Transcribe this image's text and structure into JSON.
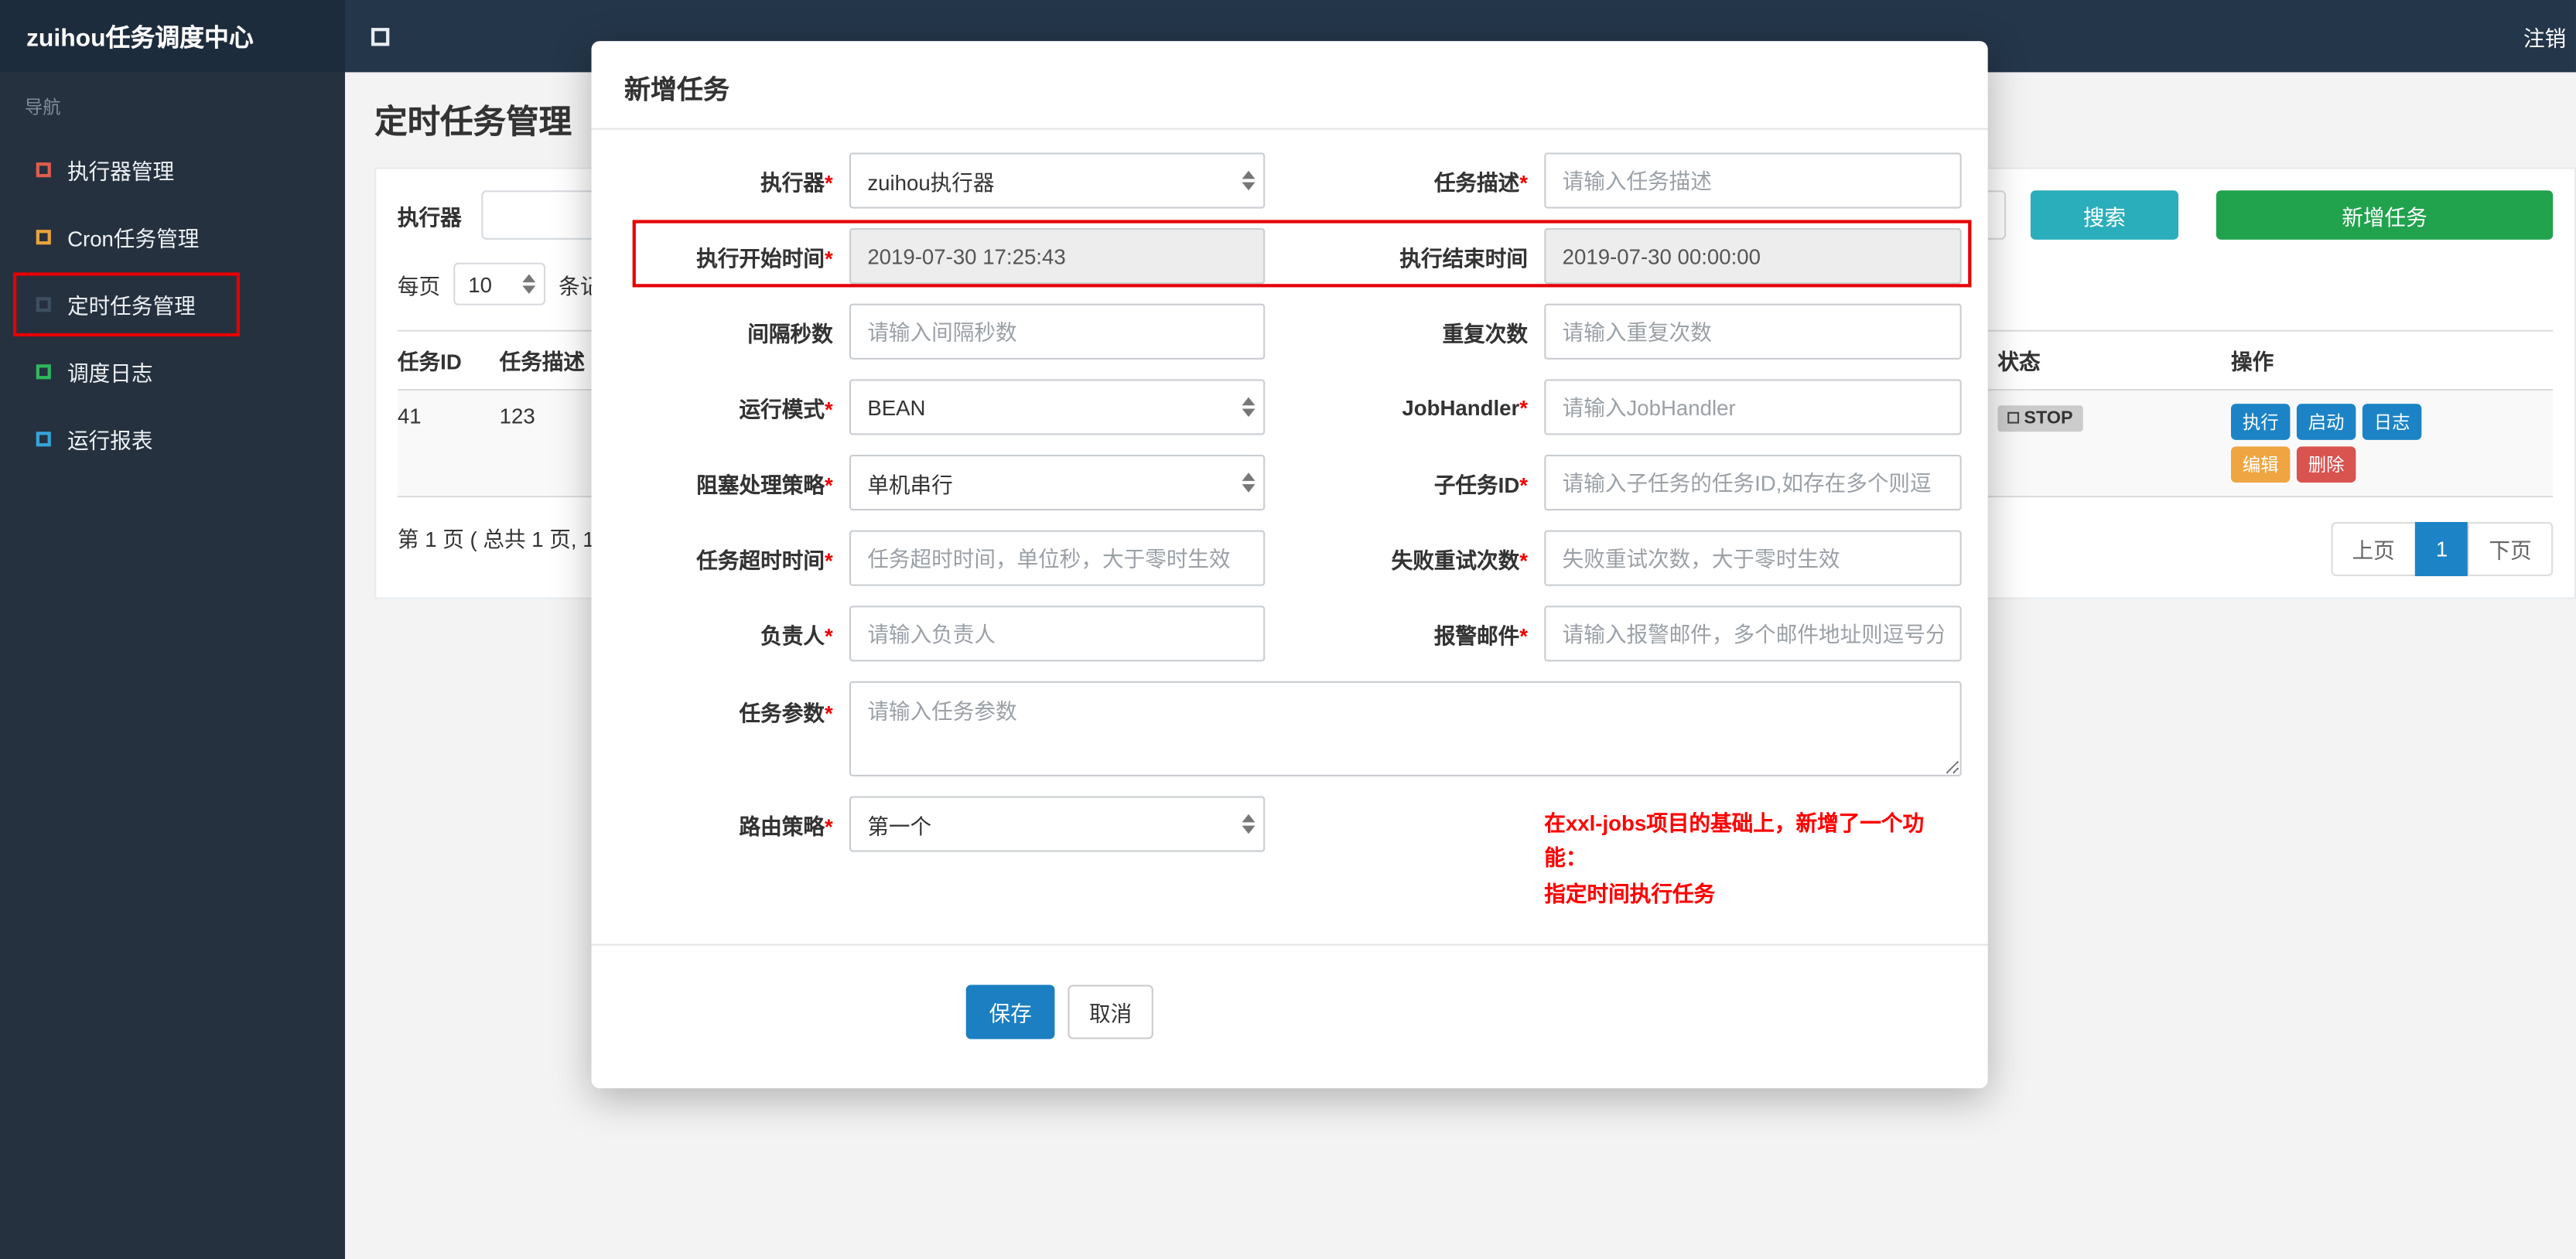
{
  "navbar": {
    "brand": "zuihou任务调度中心",
    "logout": "注销"
  },
  "sidebar": {
    "nav_label": "导航",
    "items": [
      {
        "label": "执行器管理",
        "icon_color": "#e05c4c"
      },
      {
        "label": "Cron任务管理",
        "icon_color": "#e9a33b"
      },
      {
        "label": "定时任务管理",
        "icon_color": "#3d4f61"
      },
      {
        "label": "调度日志",
        "icon_color": "#2eb85c"
      },
      {
        "label": "运行报表",
        "icon_color": "#36a3d9"
      }
    ]
  },
  "page": {
    "title": "定时任务管理",
    "filter": {
      "executor_label": "执行器",
      "search_button": "搜索",
      "add_button": "新增任务"
    },
    "page_size": {
      "prefix": "每页",
      "value": "10",
      "suffix": "条记录"
    },
    "table": {
      "columns": {
        "id": "任务ID",
        "desc": "任务描述",
        "status": "状态",
        "ops": "操作"
      },
      "row": {
        "id": "41",
        "desc": "123",
        "status": "STOP",
        "actions": [
          {
            "label": "执行",
            "color": "#1c84c6"
          },
          {
            "label": "启动",
            "color": "#1c84c6"
          },
          {
            "label": "日志",
            "color": "#1c84c6"
          },
          {
            "label": "编辑",
            "color": "#efa541"
          },
          {
            "label": "删除",
            "color": "#d9534f"
          }
        ]
      }
    },
    "pagination": {
      "summary": "第 1 页 ( 总共 1 页, 1",
      "prev": "上页",
      "page": "1",
      "next": "下页"
    }
  },
  "modal": {
    "title": "新增任务",
    "fields": {
      "executor": {
        "label": "执行器",
        "required": "*",
        "value": "zuihou执行器"
      },
      "task_desc": {
        "label": "任务描述",
        "required": "*",
        "placeholder": "请输入任务描述"
      },
      "start_time": {
        "label": "执行开始时间",
        "required": "*",
        "value": "2019-07-30 17:25:43"
      },
      "end_time": {
        "label": "执行结束时间",
        "value": "2019-07-30 00:00:00"
      },
      "interval": {
        "label": "间隔秒数",
        "placeholder": "请输入间隔秒数"
      },
      "repeat_count": {
        "label": "重复次数",
        "placeholder": "请输入重复次数"
      },
      "run_mode": {
        "label": "运行模式",
        "required": "*",
        "value": "BEAN"
      },
      "job_handler": {
        "label": "JobHandler",
        "required": "*",
        "placeholder": "请输入JobHandler"
      },
      "block_strategy": {
        "label": "阻塞处理策略",
        "required": "*",
        "value": "单机串行"
      },
      "child_job": {
        "label": "子任务ID",
        "required": "*",
        "placeholder": "请输入子任务的任务ID,如存在多个则逗"
      },
      "timeout": {
        "label": "任务超时时间",
        "required": "*",
        "placeholder": "任务超时时间，单位秒，大于零时生效"
      },
      "retry_count": {
        "label": "失败重试次数",
        "required": "*",
        "placeholder": "失败重试次数，大于零时生效"
      },
      "owner": {
        "label": "负责人",
        "required": "*",
        "placeholder": "请输入负责人"
      },
      "alarm_email": {
        "label": "报警邮件",
        "required": "*",
        "placeholder": "请输入报警邮件，多个邮件地址则逗号分"
      },
      "job_param": {
        "label": "任务参数",
        "required": "*",
        "placeholder": "请输入任务参数"
      },
      "route_strategy": {
        "label": "路由策略",
        "required": "*",
        "value": "第一个"
      }
    },
    "note": [
      "在xxl-jobs项目的基础上，新增了一个功能：",
      "指定时间执行任务"
    ],
    "save": "保存",
    "cancel": "取消"
  },
  "colors": {
    "search_button": "#2aaebb",
    "add_button": "#21a24d",
    "save_button": "#1b7fc2",
    "pagination_active": "#1c84c6",
    "status_badge_bg": "#cccccc",
    "annotation": "#e60000",
    "note_text": "#ff0000"
  }
}
